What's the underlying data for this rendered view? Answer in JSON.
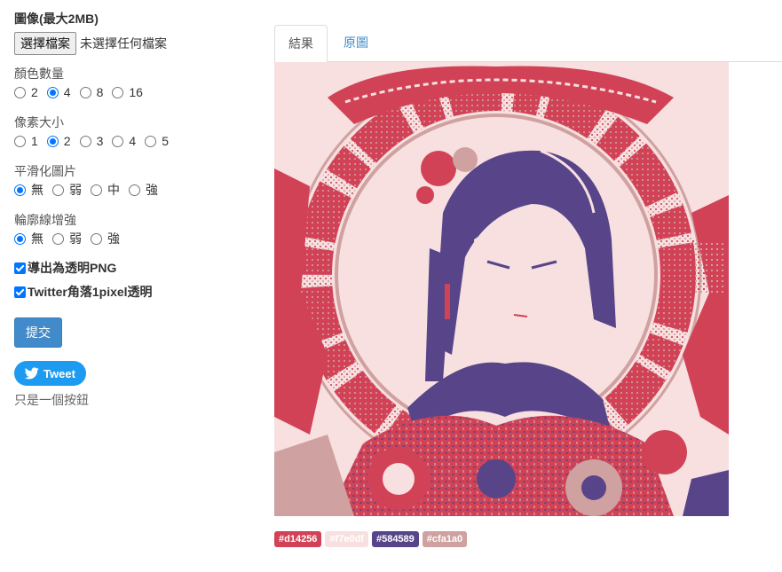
{
  "form": {
    "image_label": "圖像(最大2MB)",
    "file_button": "選擇檔案",
    "file_status": "未選擇任何檔案",
    "groups": [
      {
        "label": "顏色數量",
        "options": [
          "2",
          "4",
          "8",
          "16"
        ],
        "selected": 1
      },
      {
        "label": "像素大小",
        "options": [
          "1",
          "2",
          "3",
          "4",
          "5"
        ],
        "selected": 1
      },
      {
        "label": "平滑化圖片",
        "options": [
          "無",
          "弱",
          "中",
          "強"
        ],
        "selected": 0
      },
      {
        "label": "輪廓線增強",
        "options": [
          "無",
          "弱",
          "強"
        ],
        "selected": 0
      }
    ],
    "checkboxes": [
      {
        "label": "導出為透明PNG",
        "checked": true
      },
      {
        "label": "Twitter角落1pixel透明",
        "checked": true
      }
    ],
    "submit": "提交",
    "tweet": "Tweet",
    "note": "只是一個按鈕"
  },
  "tabs": {
    "result": "結果",
    "original": "原圖"
  },
  "palette": [
    {
      "hex": "#d14256",
      "label": "#d14256"
    },
    {
      "hex": "#f7e0df",
      "label": "#f7e0df"
    },
    {
      "hex": "#584589",
      "label": "#584589"
    },
    {
      "hex": "#cfa1a0",
      "label": "#cfa1a0"
    }
  ]
}
